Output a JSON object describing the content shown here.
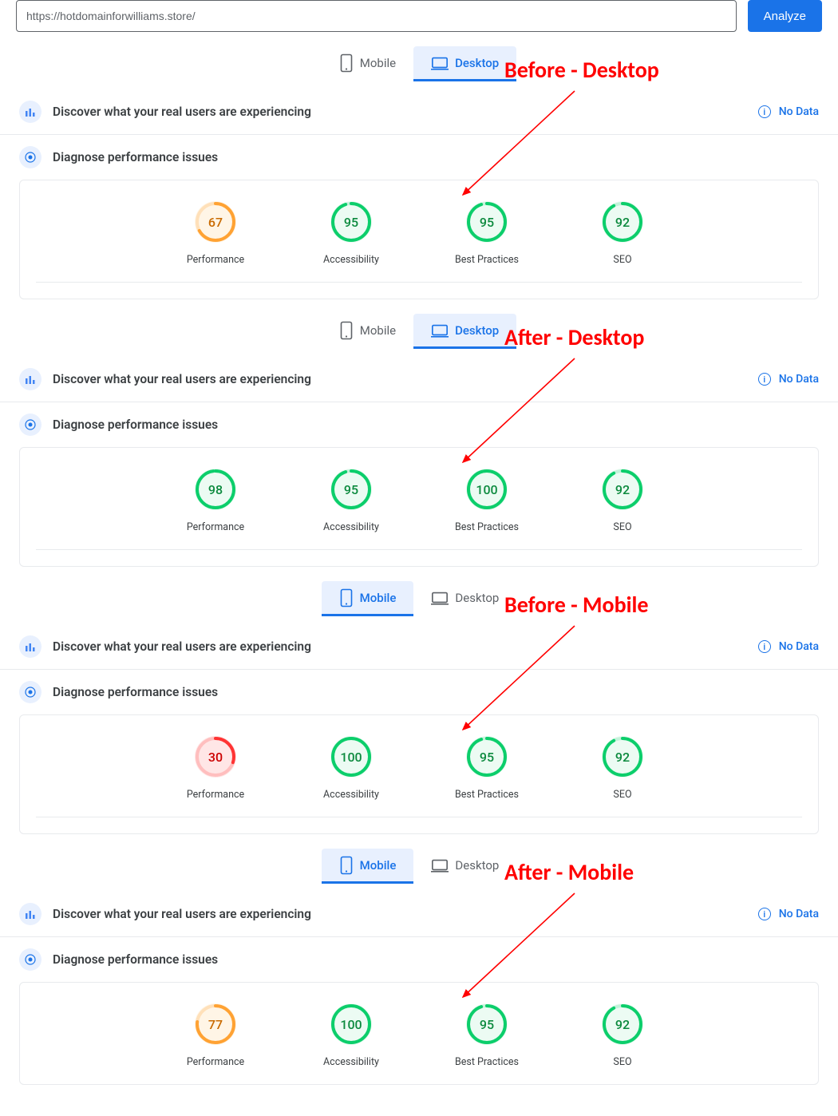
{
  "top": {
    "url": "https://hotdomainforwilliams.store/",
    "analyze_label": "Analyze"
  },
  "tab_labels": {
    "mobile": "Mobile",
    "desktop": "Desktop"
  },
  "section_labels": {
    "discover": "Discover what your real users are experiencing",
    "diagnose": "Diagnose performance issues",
    "nodata": "No Data"
  },
  "gauge_labels": {
    "performance": "Performance",
    "accessibility": "Accessibility",
    "best_practices": "Best Practices",
    "seo": "SEO"
  },
  "annotations": {
    "before_desktop": "Before - Desktop",
    "after_desktop": "After - Desktop",
    "before_mobile": "Before - Mobile",
    "after_mobile": "After - Mobile"
  },
  "chart_data": [
    {
      "type": "bar",
      "title": "Before - Desktop",
      "categories": [
        "Performance",
        "Accessibility",
        "Best Practices",
        "SEO"
      ],
      "values": [
        67,
        95,
        95,
        92
      ],
      "ylim": [
        0,
        100
      ]
    },
    {
      "type": "bar",
      "title": "After - Desktop",
      "categories": [
        "Performance",
        "Accessibility",
        "Best Practices",
        "SEO"
      ],
      "values": [
        98,
        95,
        100,
        92
      ],
      "ylim": [
        0,
        100
      ]
    },
    {
      "type": "bar",
      "title": "Before - Mobile",
      "categories": [
        "Performance",
        "Accessibility",
        "Best Practices",
        "SEO"
      ],
      "values": [
        30,
        100,
        95,
        92
      ],
      "ylim": [
        0,
        100
      ]
    },
    {
      "type": "bar",
      "title": "After - Mobile",
      "categories": [
        "Performance",
        "Accessibility",
        "Best Practices",
        "SEO"
      ],
      "values": [
        77,
        100,
        95,
        92
      ],
      "ylim": [
        0,
        100
      ]
    }
  ],
  "panels": [
    {
      "active_tab": "desktop",
      "annotation_key": "before_desktop",
      "scores": {
        "performance": 67,
        "accessibility": 95,
        "best_practices": 95,
        "seo": 92
      }
    },
    {
      "active_tab": "desktop",
      "annotation_key": "after_desktop",
      "scores": {
        "performance": 98,
        "accessibility": 95,
        "best_practices": 100,
        "seo": 92
      }
    },
    {
      "active_tab": "mobile",
      "annotation_key": "before_mobile",
      "scores": {
        "performance": 30,
        "accessibility": 100,
        "best_practices": 95,
        "seo": 92
      }
    },
    {
      "active_tab": "mobile",
      "annotation_key": "after_mobile",
      "scores": {
        "performance": 77,
        "accessibility": 100,
        "best_practices": 95,
        "seo": 92
      }
    }
  ]
}
